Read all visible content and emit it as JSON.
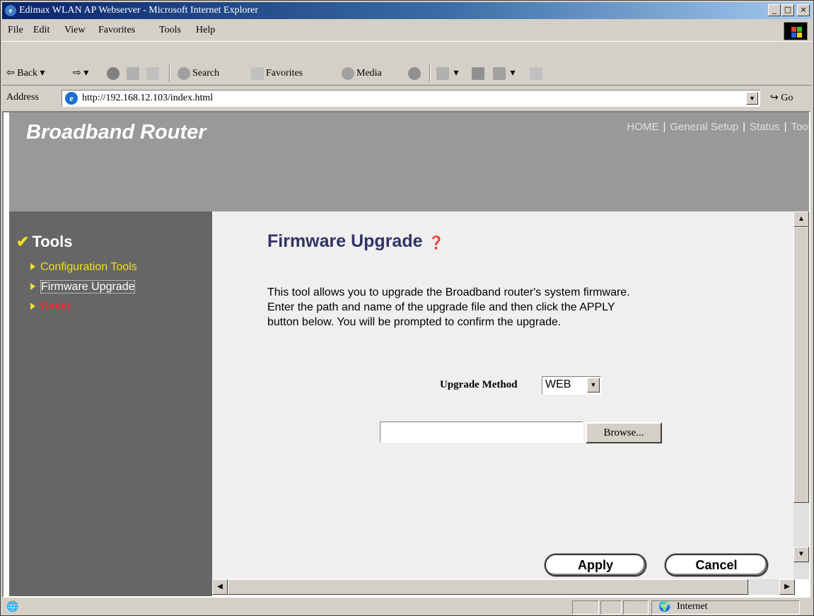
{
  "window": {
    "title": "Edimax WLAN AP Webserver - Microsoft Internet Explorer",
    "minimize": "_",
    "maximize": "□",
    "close": "×"
  },
  "menu": [
    "File",
    "Edit",
    "View",
    "Favorites",
    "Tools",
    "Help"
  ],
  "toolbar": {
    "back": "⇦ Back",
    "forward": "⇨",
    "search": "Search",
    "favorites": "Favorites",
    "media": "Media"
  },
  "address": {
    "label": "Address",
    "url": "http://192.168.12.103/index.html",
    "go": "Go"
  },
  "page": {
    "brand": "Broadband Router",
    "nav": [
      "HOME",
      "General Setup",
      "Status",
      "Tool"
    ],
    "sidebar_title": "Tools",
    "sidebar_links": [
      {
        "label": "Configuration Tools",
        "color": "#f0e020"
      },
      {
        "label": "Firmware Upgrade",
        "color": "#ffffff"
      },
      {
        "label": "Reset",
        "color": "#ff2020"
      }
    ],
    "title": "Firmware Upgrade",
    "description": [
      "This tool allows you to upgrade the Broadband router's system firmware.",
      "Enter the path and name of the upgrade file and then click the APPLY",
      "button below. You will be prompted to confirm the upgrade."
    ],
    "method_label": "Upgrade Method",
    "method_value": "WEB",
    "file_value": "",
    "browse": "Browse...",
    "apply": "Apply",
    "cancel": "Cancel"
  },
  "status": {
    "zone": "Internet"
  }
}
